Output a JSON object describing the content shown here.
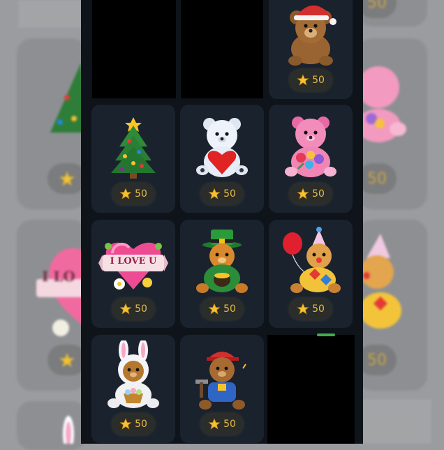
{
  "page": {
    "background_color": "#9a9c9f",
    "frame_color": "#0f141b",
    "tile_color": "#1a222d",
    "price_color": "#e8b94b"
  },
  "gifts": [
    {
      "name": "santa-teddy-bear",
      "icon": "santa-bear-icon",
      "price": "50"
    },
    {
      "name": "christmas-tree",
      "icon": "christmas-tree-icon",
      "price": "50"
    },
    {
      "name": "heart-teddy-bear",
      "icon": "heart-bear-icon",
      "price": "50"
    },
    {
      "name": "pink-flower-bear",
      "icon": "pink-flower-bear-icon",
      "price": "50"
    },
    {
      "name": "i-love-u-heart",
      "icon": "love-heart-icon",
      "heart_text": "I LOVE U",
      "price": "50"
    },
    {
      "name": "leprechaun-bear",
      "icon": "leprechaun-bear-icon",
      "price": "50"
    },
    {
      "name": "clown-balloon-bear",
      "icon": "clown-bear-icon",
      "price": "50"
    },
    {
      "name": "bunny-costume-bear",
      "icon": "bunny-bear-icon",
      "price": "50"
    },
    {
      "name": "builder-bear",
      "icon": "builder-bear-icon",
      "price": "50"
    }
  ],
  "background_blur": {
    "heart_text": "I LO",
    "prices": [
      "50",
      "50",
      "50",
      "50"
    ]
  }
}
